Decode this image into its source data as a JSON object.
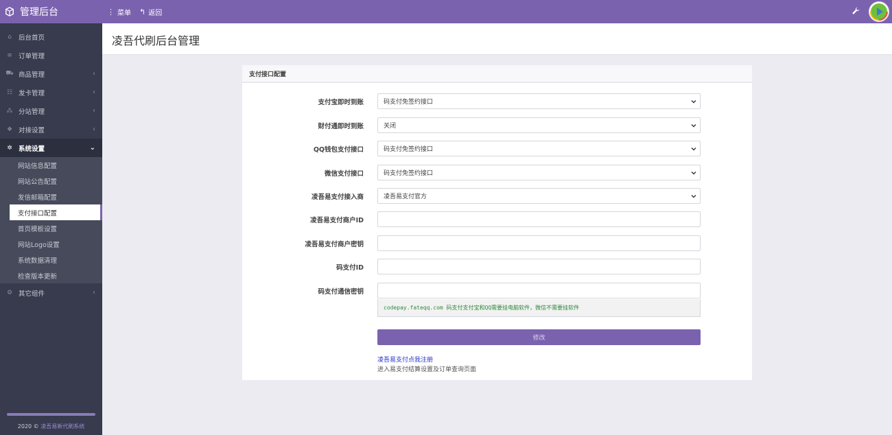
{
  "brand": {
    "title": "管理后台"
  },
  "topbar": {
    "menu_label": "菜单",
    "back_label": "返回"
  },
  "sidebar": {
    "items": [
      {
        "label": "后台首页",
        "icon": "home-icon"
      },
      {
        "label": "订单管理",
        "icon": "list-icon"
      },
      {
        "label": "商品管理",
        "icon": "cart-icon",
        "has_children": true
      },
      {
        "label": "发卡管理",
        "icon": "grid-icon",
        "has_children": true
      },
      {
        "label": "分站管理",
        "icon": "sitemap-icon",
        "has_children": true
      },
      {
        "label": "对接设置",
        "icon": "cubes-icon",
        "has_children": true
      },
      {
        "label": "系统设置",
        "icon": "gear-icon",
        "has_children": true,
        "expanded": true
      }
    ],
    "submenu": [
      {
        "label": "网站信息配置"
      },
      {
        "label": "网站公告配置"
      },
      {
        "label": "发信邮箱配置"
      },
      {
        "label": "支付接口配置",
        "current": true
      },
      {
        "label": "首页模板设置"
      },
      {
        "label": "网站Logo设置"
      },
      {
        "label": "系统数据清理"
      },
      {
        "label": "检查版本更新"
      }
    ],
    "bottom_item": {
      "label": "其它组件",
      "icon": "gears-icon"
    },
    "footer": {
      "year": "2020 ©",
      "link": "凌吾易新代刷系统"
    }
  },
  "page": {
    "title": "凌吾代刷后台管理"
  },
  "panel": {
    "title": "支付接口配置",
    "fields": [
      {
        "label": "支付宝即时到账",
        "type": "select",
        "value": "码支付免签约接口"
      },
      {
        "label": "财付通即时到账",
        "type": "select",
        "value": "关闭"
      },
      {
        "label": "QQ钱包支付接口",
        "type": "select",
        "value": "码支付免签约接口"
      },
      {
        "label": "微信支付接口",
        "type": "select",
        "value": "码支付免签约接口"
      },
      {
        "label": "凌吾易支付接入商",
        "type": "select",
        "value": "凌吾易支付官方"
      },
      {
        "label": "凌吾易支付商户ID",
        "type": "input",
        "value": ""
      },
      {
        "label": "凌吾易支付商户密钥",
        "type": "input",
        "value": ""
      },
      {
        "label": "码支付ID",
        "type": "input",
        "value": ""
      },
      {
        "label": "码支付通信密钥",
        "type": "input",
        "value": ""
      }
    ],
    "help_text": "codepay.fateqq.com 码支付支付宝和QQ需要挂电脑软件，微信不需要挂软件",
    "submit_label": "修改",
    "link_register": "凌吾易支付点我注册",
    "link_note": "进入易支付结算设置及订单查询页面"
  },
  "colors": {
    "accent": "#7b62ae",
    "sidebar": "#373b4d",
    "background": "#ecebf1"
  }
}
